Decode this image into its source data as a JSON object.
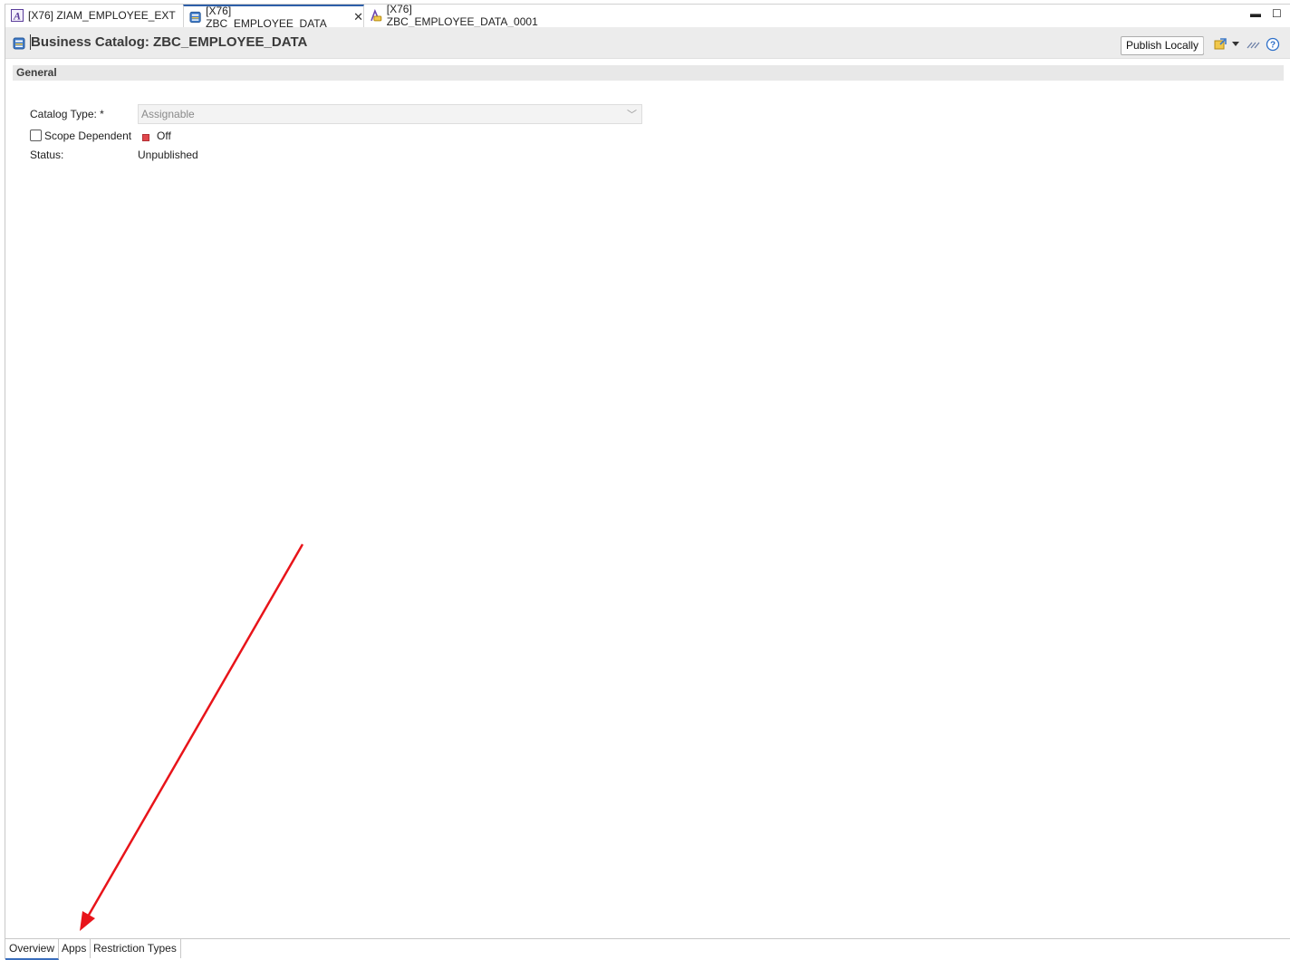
{
  "tabs": [
    {
      "label": "[X76] ZIAM_EMPLOYEE_EXT",
      "icon": "access-control-icon"
    },
    {
      "label": "[X76] ZBC_EMPLOYEE_DATA",
      "icon": "business-catalog-icon",
      "active": true
    },
    {
      "label": "[X76] ZBC_EMPLOYEE_DATA_0001",
      "icon": "catalog-assignment-icon"
    }
  ],
  "window": {
    "minimize": "▬",
    "maximize": "☐"
  },
  "header": {
    "title": "Business Catalog: ZBC_EMPLOYEE_DATA",
    "publish_label": "Publish Locally"
  },
  "general": {
    "section_title": "General",
    "catalog_type_label": "Catalog Type: *",
    "catalog_type_value": "Assignable",
    "scope_dependent_label": "Scope Dependent",
    "scope_value": "Off",
    "status_label": "Status:",
    "status_value": "Unpublished"
  },
  "bottom_tabs": [
    {
      "label": "Overview",
      "active": true
    },
    {
      "label": "Apps"
    },
    {
      "label": "Restriction Types"
    }
  ],
  "colors": {
    "accent": "#2d5fa8",
    "annotation": "#e8141a",
    "off_indicator": "#e0474c"
  }
}
